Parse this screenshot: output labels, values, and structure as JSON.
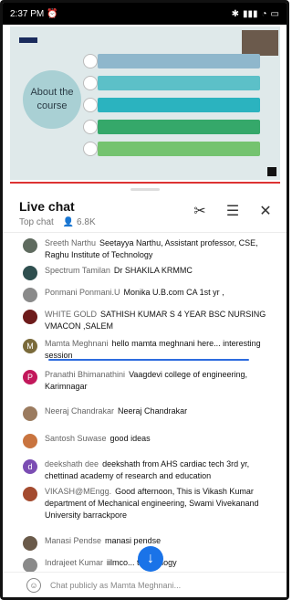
{
  "status": {
    "time": "2:37 PM",
    "left_icon": "alarm-icon",
    "right_icons": [
      "bluetooth-icon",
      "signal-icon",
      "wifi-icon",
      "battery-icon"
    ]
  },
  "video": {
    "left_title": "About the course"
  },
  "chat": {
    "title": "Live chat",
    "subtitle": {
      "mode": "Top chat",
      "viewers": "6.8K"
    },
    "header_icons": [
      "scissors-icon",
      "filter-icon",
      "close-icon"
    ],
    "messages": [
      {
        "avatar_color": "#5f6b5f",
        "name": "Sreeth Narthu",
        "text": "Seetayya Narthu, Assistant professor, CSE, Raghu Institute of Technology"
      },
      {
        "avatar_color": "#2f4f4f",
        "name": "Spectrum Tamilan",
        "text": "Dr SHAKILA KRMMC"
      },
      {
        "avatar_color": "#8a8a8a",
        "name": "Ponmani Ponmani.U",
        "text": "Monika U.B.com CA 1st yr ,"
      },
      {
        "avatar_color": "#6d1b1b",
        "name": "WHITE GOLD",
        "text": "SATHISH KUMAR S 4 YEAR BSC NURSING VMACON ,SALEM"
      },
      {
        "avatar_color": "#7a6a3a",
        "name": "Mamta Meghnani",
        "text": "hello mamta meghnani here... interesting session"
      },
      {
        "avatar_color": "#c2185b",
        "name": "Pranathi Bhimanathini",
        "text": "Vaagdevi college of engineering, Karimnagar"
      },
      {
        "avatar_color": "#9b7b5f",
        "name": "Neeraj Chandrakar",
        "text": "Neeraj Chandrakar"
      },
      {
        "avatar_color": "#c9743f",
        "name": "Santosh Suwase",
        "text": "good ideas"
      },
      {
        "avatar_color": "#7b4db3",
        "name": "deekshath dee",
        "text": "deekshath from AHS cardiac tech 3rd yr, chettinad academy of research and education"
      },
      {
        "avatar_color": "#a44b2f",
        "name": "VIKASH@MEngg.",
        "text": "Good afternoon, This is Vikash Kumar department of Mechanical engineering, Swami Vivekanand University barrackpore"
      },
      {
        "avatar_color": "#6a5a4a",
        "name": "Manasi Pendse",
        "text": "manasi pendse"
      },
      {
        "avatar_color": "#8a8a8a",
        "name": "Indrajeet Kumar",
        "text": "iilmco... technology"
      }
    ],
    "scroll_button_icon": "arrow-down-icon",
    "composer": {
      "placeholder": "Chat publicly as Mamta Meghnani...",
      "emoji_icon": "smile-icon"
    }
  }
}
